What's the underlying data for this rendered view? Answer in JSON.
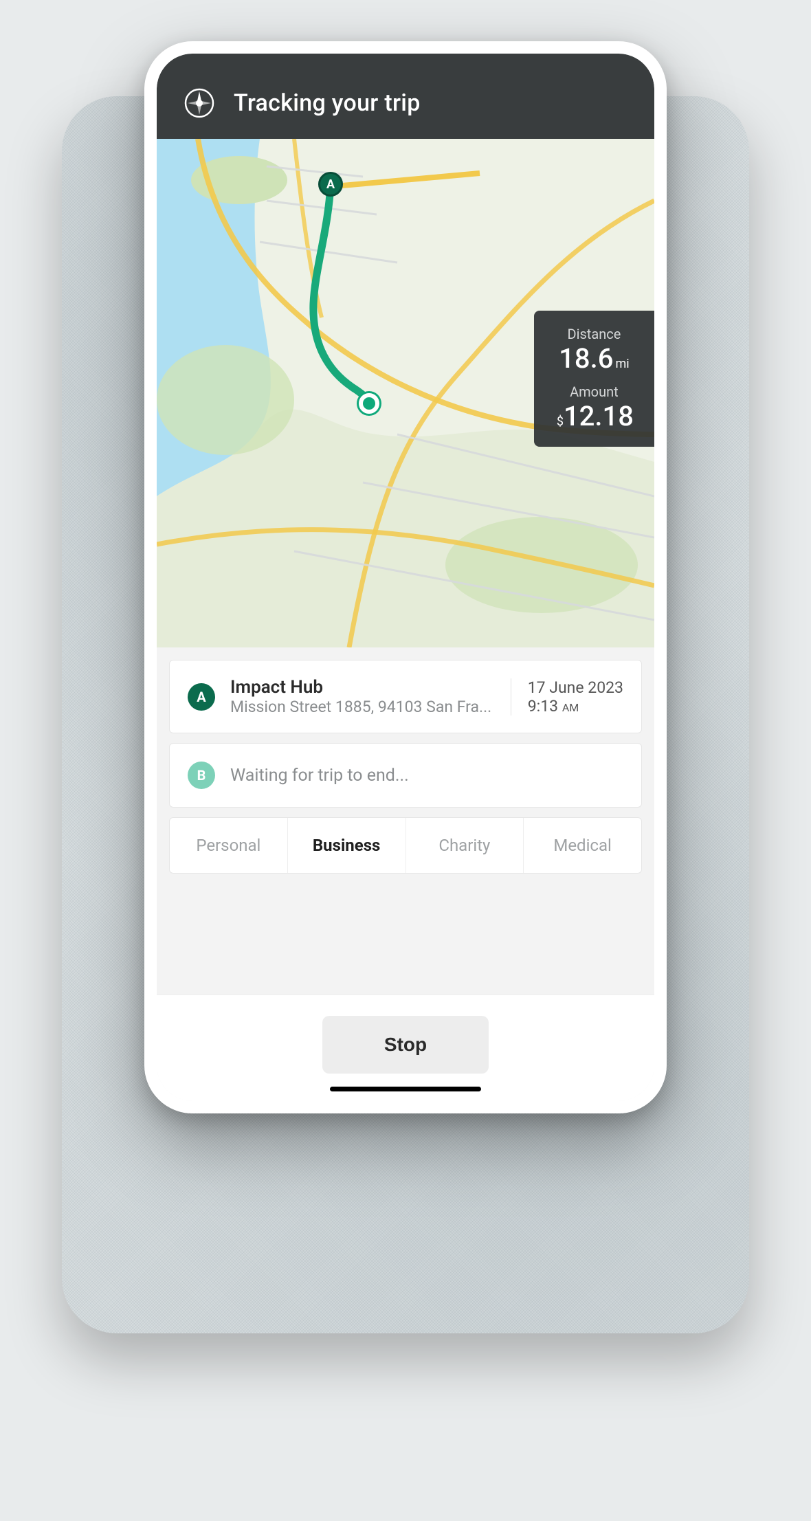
{
  "header": {
    "title": "Tracking your trip"
  },
  "stats": {
    "distance_label": "Distance",
    "distance_value": "18.6",
    "distance_unit": "mi",
    "amount_label": "Amount",
    "amount_currency": "$",
    "amount_value": "12.18"
  },
  "origin": {
    "badge": "A",
    "name": "Impact Hub",
    "address": "Mission Street 1885, 94103 San Fra...",
    "date": "17 June 2023",
    "time": "9:13",
    "ampm": "AM"
  },
  "destination": {
    "badge": "B",
    "status": "Waiting for trip to end..."
  },
  "categories": {
    "items": [
      "Personal",
      "Business",
      "Charity",
      "Medical"
    ],
    "active_index": 1
  },
  "actions": {
    "stop": "Stop"
  }
}
